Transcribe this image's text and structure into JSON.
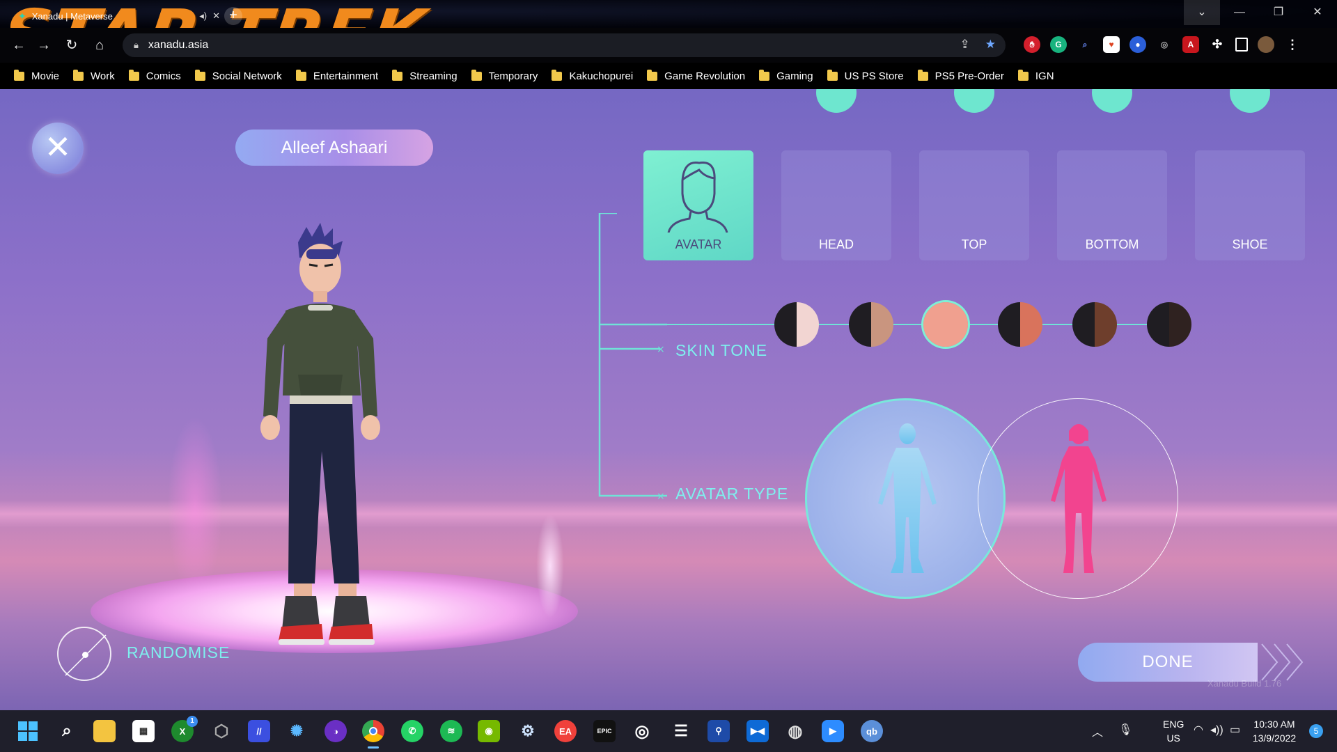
{
  "browser": {
    "tab_title": "Xanadu | Metaverse",
    "address": "xanadu.asia",
    "bookmarks": [
      "Movie",
      "Work",
      "Comics",
      "Social Network",
      "Entertainment",
      "Streaming",
      "Temporary",
      "Kakuchopurei",
      "Game Revolution",
      "Gaming",
      "US PS Store",
      "PS5 Pre-Order",
      "IGN"
    ],
    "theme_logo": "STAR TREK"
  },
  "app": {
    "player_name": "Alleef Ashaari",
    "tabs": [
      {
        "label": "AVATAR",
        "active": true
      },
      {
        "label": "HEAD",
        "active": false
      },
      {
        "label": "TOP",
        "active": false
      },
      {
        "label": "BOTTOM",
        "active": false
      },
      {
        "label": "SHOE",
        "active": false
      }
    ],
    "skin_tone_label": "SKIN TONE",
    "skin_tones": [
      {
        "left": "#1f1d22",
        "right": "#f2d5d2"
      },
      {
        "left": "#1f1d22",
        "right": "#c9957f"
      },
      {
        "left": "#f0a08f",
        "right": "#f0a08f",
        "selected": true
      },
      {
        "left": "#1f1d22",
        "right": "#d9735c"
      },
      {
        "left": "#1f1d22",
        "right": "#6e3e2c"
      },
      {
        "left": "#1f1d22",
        "right": "#2f2220"
      }
    ],
    "avatar_type_label": "AVATAR TYPE",
    "avatar_types": [
      {
        "name": "male-silhouette",
        "color": "#8fd2ee",
        "selected": true
      },
      {
        "name": "female-silhouette",
        "color": "#f2448f",
        "selected": false
      }
    ],
    "randomise_label": "RANDOMISE",
    "done_label": "DONE",
    "build_label": "Xanadu Build 1.76",
    "colors": {
      "accent": "#7ef0ee",
      "active_tab": "#6ee6cf"
    }
  },
  "taskbar": {
    "apps": [
      "start",
      "search",
      "file-explorer",
      "microsoft-store",
      "xbox",
      "epic-launcher",
      "nvidia-app",
      "battle-net",
      "tor",
      "chrome",
      "whatsapp",
      "spotify",
      "geforce",
      "steam",
      "ea",
      "epic-games",
      "ubisoft",
      "game-launcher",
      "playstation",
      "visual-studio",
      "obs",
      "zoom",
      "qbittorrent"
    ],
    "xbox_badge": "1",
    "lang_top": "ENG",
    "lang_bottom": "US",
    "time": "10:30 AM",
    "date": "13/9/2022",
    "notifications": "5"
  }
}
